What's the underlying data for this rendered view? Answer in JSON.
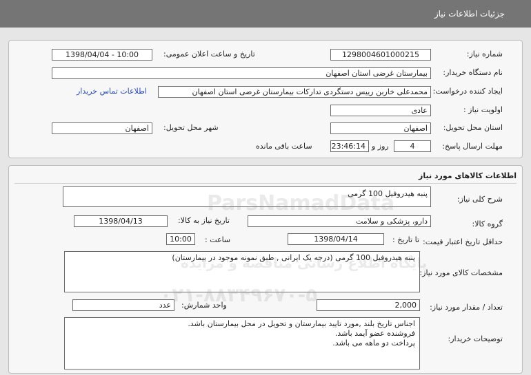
{
  "header": {
    "title": "جزئیات اطلاعات نیاز"
  },
  "info": {
    "need_number_label": "شماره نیاز:",
    "need_number": "1298004601000215",
    "announce_label": "تاریخ و ساعت اعلان عمومی:",
    "announce_value": "1398/04/04 - 10:00",
    "buyer_label": "نام دستگاه خریدار:",
    "buyer_value": "بیمارستان غرضی استان اصفهان",
    "creator_label": "ایجاد کننده درخواست:",
    "creator_value": "محمدعلی خاربن رییس دستگردی تدارکات بیمارستان غرضی استان اصفهان",
    "contact_link": "اطلاعات تماس خریدار",
    "priority_label": "اولویت نیاز :",
    "priority_value": "عادی",
    "province_label": "استان محل تحویل:",
    "province_value": "اصفهان",
    "city_label": "شهر محل تحویل:",
    "city_value": "اصفهان",
    "deadline_label": "مهلت ارسال پاسخ:",
    "days_value": "4",
    "days_text": "روز و",
    "time_value": "23:46:14",
    "remaining_text": "ساعت باقی مانده"
  },
  "goods": {
    "section_title": "اطلاعات کالاهای مورد نیاز",
    "summary_label": "شرح کلی نیاز:",
    "summary_value": "پنبه هیدروفیل 100 گرمی",
    "group_label": "گروه کالا:",
    "group_value": "دارو، پزشکی و سلامت",
    "need_date_label": "تاریخ نیاز به کالا:",
    "need_date_value": "1398/04/13",
    "validity_label": "حداقل تاریخ اعتبار قیمت:",
    "to_date_label": "تا تاریخ :",
    "to_date_value": "1398/04/14",
    "hour_label": "ساعت :",
    "hour_value": "10:00",
    "specs_label": "مشخصات کالای مورد نیاز:",
    "specs_value": "پنبه هیدروفیل 100 گرمی (درجه یک ایرانی , طبق نمونه موجود در بیمارستان)",
    "qty_label": "تعداد / مقدار مورد نیاز:",
    "qty_value": "2,000",
    "unit_label": "واحد شمارش:",
    "unit_value": "عدد",
    "notes_label": "توضیحات خریدار:",
    "notes_lines": [
      "اجناس تاریخ بلند ,مورد تایید بیمارستان و تحویل در محل بیمارستان باشد.",
      "فروشنده عضو آیمد باشد.",
      "پرداخت دو ماهه می باشد."
    ]
  },
  "watermark": {
    "brand": "ParsNamadData",
    "line1": "پایگاه اطلاع رسانی مناقصه و مزایده",
    "line2": "۰۲۱-۸۸۳۴۹۶۷۰-۵"
  }
}
